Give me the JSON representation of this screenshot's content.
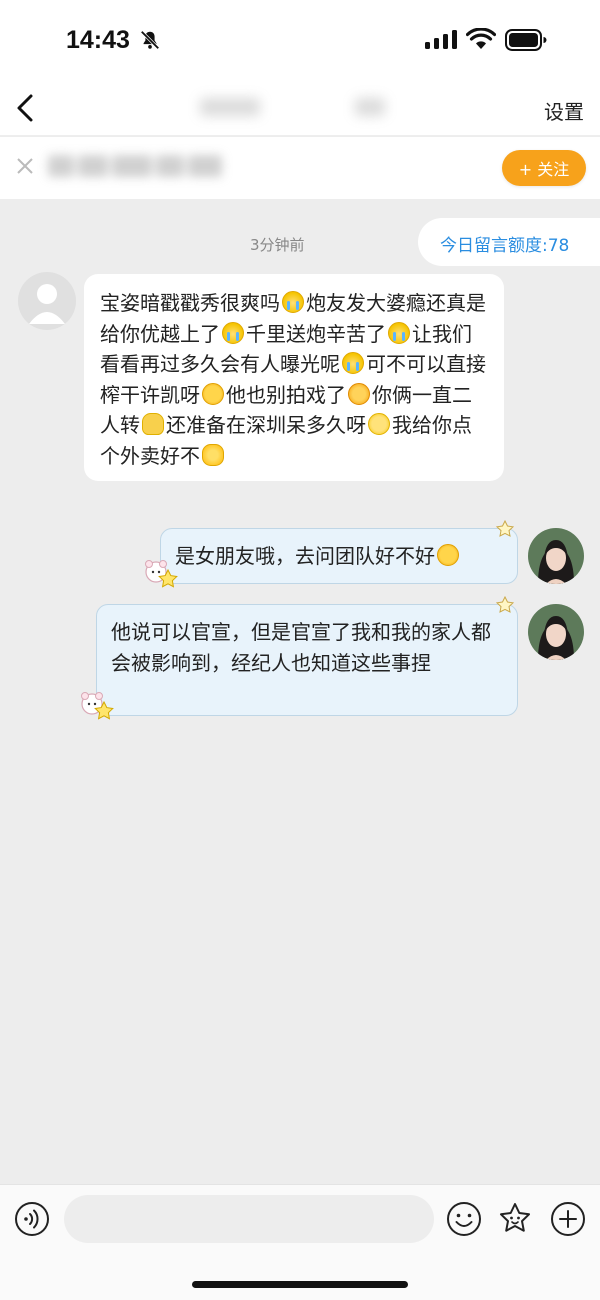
{
  "status_bar": {
    "time": "14:43",
    "icons": [
      "bell-slash-icon",
      "cellular-signal-icon",
      "wifi-icon",
      "battery-icon"
    ]
  },
  "nav": {
    "back_icon": "chevron-left-icon",
    "settings_label": "设置"
  },
  "follow_bar": {
    "close_icon": "close-icon",
    "follow_label": "+ 关注",
    "follow_color": "#f7a21b"
  },
  "chat": {
    "timestamp": "3分钟前",
    "quota_text": "今日留言额度:78",
    "quota_color": "#2a8de0",
    "incoming": {
      "segments": [
        {
          "text": "宝姿暗戳戳秀很爽吗",
          "emoji": "cry"
        },
        {
          "text": "炮友发大婆瘾还真是给你优越上了",
          "emoji": "cry"
        },
        {
          "text": "千里送炮辛苦了",
          "emoji": "cry"
        },
        {
          "text": "让我们看看再过多久会有人曝光呢",
          "emoji": "cry"
        },
        {
          "text": "可不可以直接榨干许凯呀",
          "emoji": "blush"
        },
        {
          "text": "他也别拍戏了",
          "emoji": "scream"
        },
        {
          "text": "你俩一直二人转",
          "emoji": "spin"
        },
        {
          "text": "还准备在深圳呆多久呀",
          "emoji": "plead"
        },
        {
          "text": "我给你点个外卖好不",
          "emoji": "flower"
        }
      ]
    },
    "outgoing": [
      {
        "text": "是女朋友哦，去问团队好不好",
        "emoji": "blush"
      },
      {
        "text": "他说可以官宣，但是官宣了我和我的家人都会被影响到，经纪人也知道这些事捏"
      }
    ]
  },
  "input_bar": {
    "placeholder": "",
    "icons": [
      "voice-icon",
      "smile-icon",
      "sticker-icon",
      "plus-icon"
    ]
  }
}
